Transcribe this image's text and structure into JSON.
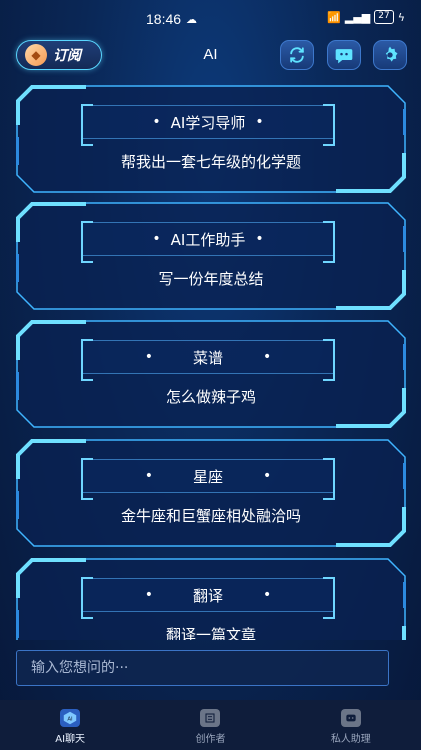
{
  "status": {
    "time": "18:46",
    "battery": "27"
  },
  "header": {
    "subscribe_label": "订阅",
    "title": "AI"
  },
  "cards": [
    {
      "title": "AI学习导师",
      "prompt": "帮我出一套七年级的化学题"
    },
    {
      "title": "AI工作助手",
      "prompt": "写一份年度总结"
    },
    {
      "title": "菜谱",
      "prompt": "怎么做辣子鸡"
    },
    {
      "title": "星座",
      "prompt": "金牛座和巨蟹座相处融洽吗"
    },
    {
      "title": "翻译",
      "prompt": "翻译一篇文章"
    }
  ],
  "input": {
    "placeholder": "输入您想问的···"
  },
  "nav": [
    {
      "label": "AI聊天",
      "active": true
    },
    {
      "label": "创作者",
      "active": false
    },
    {
      "label": "私人助理",
      "active": false
    }
  ],
  "colors": {
    "accent": "#59d6ff",
    "frame": "#3fb4ff",
    "background": "#0a2756"
  }
}
